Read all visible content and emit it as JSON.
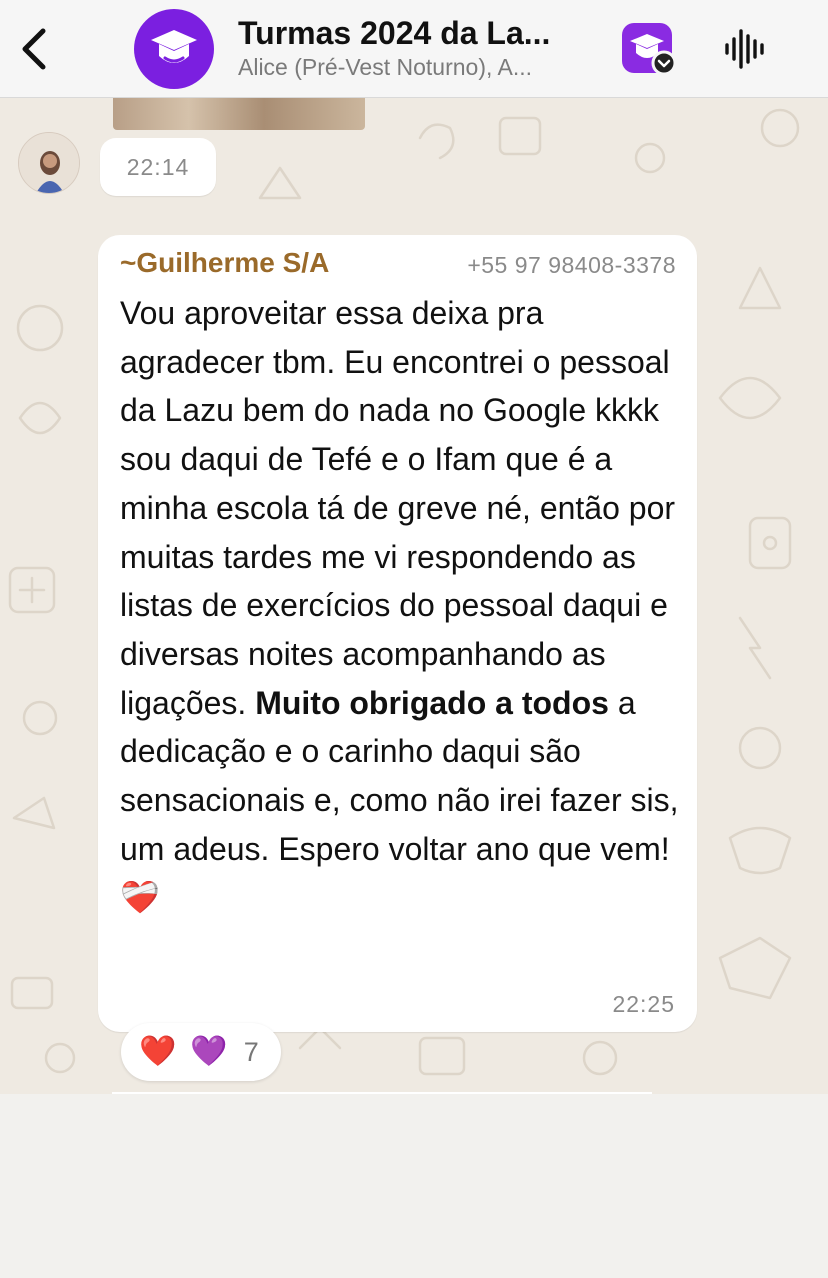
{
  "header": {
    "title": "Turmas 2024 da La...",
    "subtitle": "Alice (Pré-Vest Noturno), A...",
    "back_icon": "chevron-left-icon",
    "group_icon": "graduation-cap-icon",
    "community_icon": "community-icon",
    "audio_icon": "audio-wave-icon",
    "accent_color": "#7b1fe0"
  },
  "chat": {
    "previous_message": {
      "time": "22:14"
    },
    "message": {
      "sender_prefix": "~",
      "sender_name": "Guilherme S/A",
      "sender_phone": "+55 97 98408-3378",
      "text_part1": "Vou aproveitar essa deixa pra agradecer tbm. Eu encontrei o pessoal da Lazu bem do nada no Google kkkk sou daqui de Tefé e o Ifam que é a minha escola tá de greve né, então por muitas tardes me vi respondendo as listas de exercícios do pessoal daqui e diversas noites acompanhando as ligações.",
      "text_bold": "Muito obrigado a todos",
      "text_part2": " a dedicação e o carinho daqui são sensacionais e, como não irei fazer sis, um adeus. Espero voltar ano que vem!",
      "text_emoji": "❤️‍🩹",
      "time": "22:25",
      "sender_color": "#9a6a2a"
    },
    "reactions": {
      "emoji1": "❤️",
      "emoji2": "💜",
      "count": "7"
    }
  }
}
